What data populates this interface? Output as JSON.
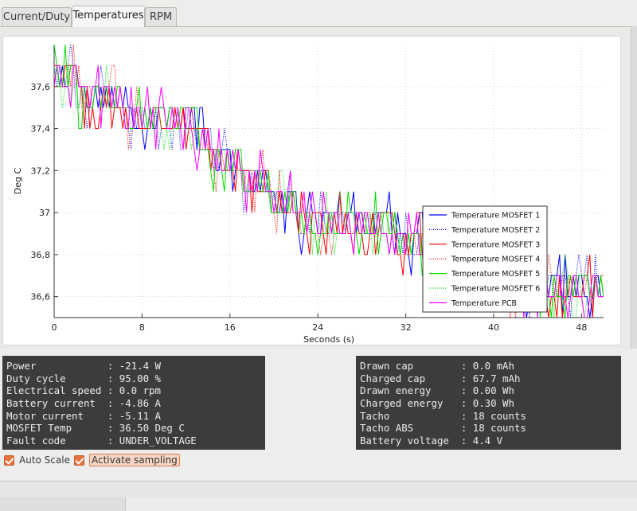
{
  "tabs": [
    {
      "label": "Current/Duty"
    },
    {
      "label": "Temperatures"
    },
    {
      "label": "RPM"
    }
  ],
  "active_tab": "Temperatures",
  "chart_data": {
    "type": "line",
    "title": "",
    "xlabel": "Seconds (s)",
    "ylabel": "Deg C",
    "xlim": [
      0,
      50
    ],
    "ylim": [
      36.5,
      37.8
    ],
    "x_ticks": [
      "0",
      "8",
      "16",
      "24",
      "32",
      "40",
      "48"
    ],
    "y_ticks": [
      "36,6",
      "36,8",
      "37",
      "37,2",
      "37,4",
      "37,6"
    ],
    "grid": true,
    "legend_position": "right",
    "series": [
      {
        "name": "Temperature MOSFET 1",
        "color": "#0000ff",
        "style": "solid"
      },
      {
        "name": "Temperature MOSFET 2",
        "color": "#0000ff",
        "style": "dotted"
      },
      {
        "name": "Temperature MOSFET 3",
        "color": "#ff0000",
        "style": "solid"
      },
      {
        "name": "Temperature MOSFET 4",
        "color": "#ff0000",
        "style": "dotted"
      },
      {
        "name": "Temperature MOSFET 5",
        "color": "#00dd00",
        "style": "solid"
      },
      {
        "name": "Temperature MOSFET 6",
        "color": "#00dd00",
        "style": "dotted"
      },
      {
        "name": "Temperature PCB",
        "color": "#ff00ff",
        "style": "solid"
      }
    ],
    "trend": {
      "x": [
        0,
        2,
        6,
        10,
        12.5,
        14,
        17,
        19.5,
        22,
        26,
        31,
        34,
        38,
        41,
        46,
        50
      ],
      "y": [
        37.7,
        37.6,
        37.5,
        37.5,
        37.4,
        37.3,
        37.2,
        37.1,
        37.0,
        37.0,
        36.9,
        36.9,
        36.8,
        36.7,
        36.7,
        36.6
      ]
    }
  },
  "left_info": [
    {
      "label": "Power",
      "value": "-21.4 W"
    },
    {
      "label": "Duty cycle",
      "value": "95.00 %"
    },
    {
      "label": "Electrical speed",
      "value": "0.0 rpm"
    },
    {
      "label": "Battery current",
      "value": "-4.86 A"
    },
    {
      "label": "Motor current",
      "value": "-5.11 A"
    },
    {
      "label": "MOSFET Temp",
      "value": "36.50 Deg C"
    },
    {
      "label": "Fault code",
      "value": "UNDER_VOLTAGE"
    }
  ],
  "right_info": [
    {
      "label": "Drawn cap",
      "value": "0.0 mAh"
    },
    {
      "label": "Charged cap",
      "value": "67.7 mAh"
    },
    {
      "label": "Drawn energy",
      "value": "0.00 Wh"
    },
    {
      "label": "Charged energy",
      "value": "0.30 Wh"
    },
    {
      "label": "Tacho",
      "value": "18 counts"
    },
    {
      "label": "Tacho ABS",
      "value": "18 counts"
    },
    {
      "label": "Battery voltage",
      "value": "4.4 V"
    }
  ],
  "controls": {
    "auto_scale_label": "Auto Scale",
    "auto_scale_checked": true,
    "activate_sampling_label": "Activate sampling",
    "activate_sampling_checked": true
  }
}
